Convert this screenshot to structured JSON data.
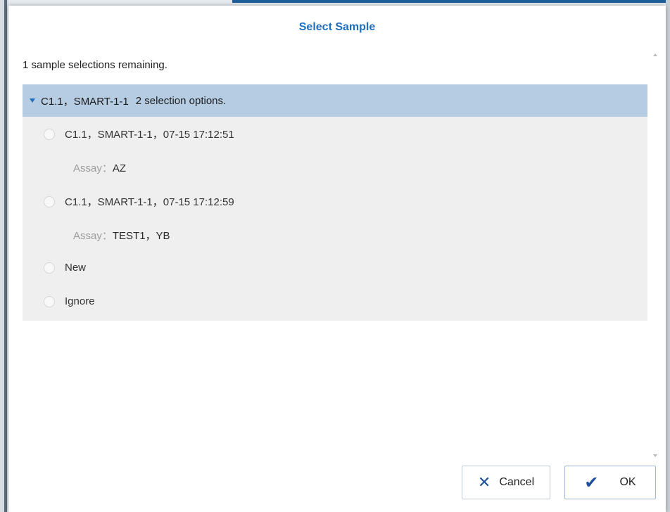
{
  "dialog": {
    "title": "Select Sample",
    "remaining_text": "1 sample selections remaining."
  },
  "group": {
    "name": "C1.1，SMART-1-1",
    "options_count_text": "2 selection options.",
    "options": [
      {
        "label": "C1.1，SMART-1-1，07-15 17:12:51",
        "assay_key": "Assay：",
        "assay_value": "AZ",
        "selected": false
      },
      {
        "label": "C1.1，SMART-1-1，07-15 17:12:59",
        "assay_key": "Assay：",
        "assay_value": "TEST1，YB",
        "selected": false
      },
      {
        "label": "New",
        "selected": false
      },
      {
        "label": "Ignore",
        "selected": false
      }
    ]
  },
  "buttons": {
    "cancel_label": "Cancel",
    "cancel_icon": "x-icon",
    "ok_label": "OK",
    "ok_icon": "check-icon"
  },
  "colors": {
    "title": "#1f6fbf",
    "group_header_bg": "#b6cce3",
    "group_body_bg": "#efefef"
  }
}
